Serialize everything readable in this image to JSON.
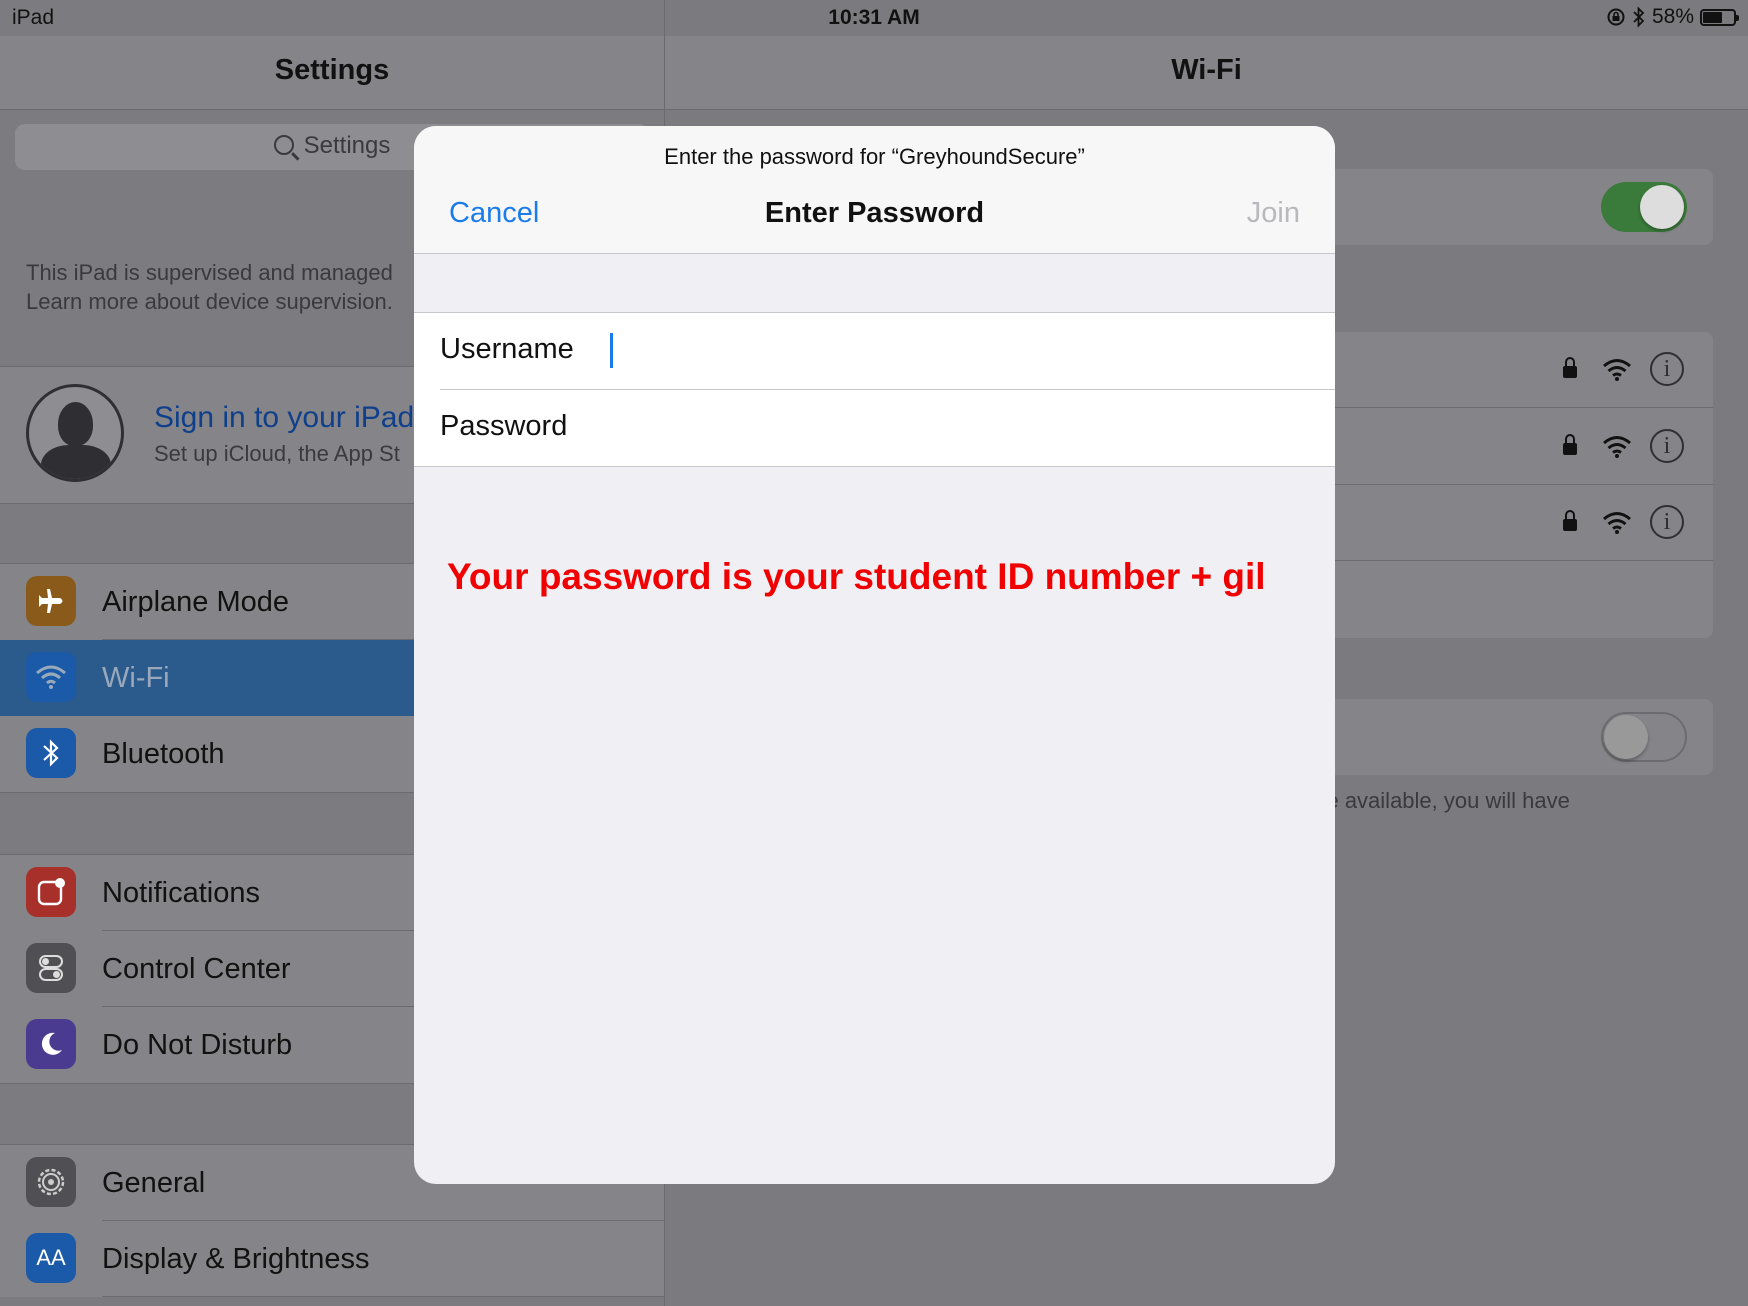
{
  "status_bar": {
    "device": "iPad",
    "time": "10:31 AM",
    "battery_percent": "58%",
    "battery_level": 0.58,
    "icons": [
      "rotation-lock-icon",
      "bluetooth-icon",
      "battery-icon"
    ]
  },
  "master": {
    "title": "Settings",
    "search_placeholder": "Settings",
    "supervision_line1": "This iPad is supervised and managed",
    "supervision_line2": "Learn more about device supervision.",
    "profile": {
      "title": "Sign in to your iPad",
      "subtitle": "Set up iCloud, the App St"
    },
    "group1": [
      {
        "label": "Airplane Mode",
        "icon": "airplane-icon",
        "color": "#8a5a1a"
      },
      {
        "label": "Wi-Fi",
        "icon": "wifi-icon",
        "color": "#1a5aa8",
        "selected": true
      },
      {
        "label": "Bluetooth",
        "icon": "bluetooth-icon",
        "color": "#1a5aa8"
      }
    ],
    "group2": [
      {
        "label": "Notifications",
        "icon": "notifications-icon",
        "color": "#a8302a"
      },
      {
        "label": "Control Center",
        "icon": "control-center-icon",
        "color": "#505054"
      },
      {
        "label": "Do Not Disturb",
        "icon": "moon-icon",
        "color": "#4a3a90"
      }
    ],
    "group3": [
      {
        "label": "General",
        "icon": "gear-icon",
        "color": "#505054"
      },
      {
        "label": "Display & Brightness",
        "icon": "display-icon",
        "color": "#1a5aa8",
        "glyph": "AA"
      }
    ]
  },
  "detail": {
    "title": "Wi-Fi",
    "wifi_enabled": true,
    "ask_to_join_enabled": false,
    "footnote": "etworks are available, you will have"
  },
  "modal": {
    "prompt": "Enter the password for “GreyhoundSecure”",
    "cancel": "Cancel",
    "title": "Enter Password",
    "join": "Join",
    "username_label": "Username",
    "username_value": "",
    "password_label": "Password",
    "password_value": "",
    "notice": "Your password is your student ID number + gil"
  },
  "colors": {
    "accent": "#1a7bea",
    "notice": "#f00000",
    "selected_row": "#2b5a8c"
  }
}
